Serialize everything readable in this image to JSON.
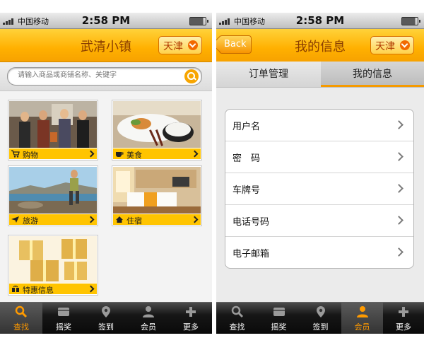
{
  "left_screen": {
    "status": {
      "carrier": "中国移动",
      "time": "2:58 PM"
    },
    "title": "武清小镇",
    "city": "天津",
    "search_placeholder": "请输入商品或商铺名称、关键字",
    "tiles": [
      {
        "label": "购物",
        "icon": "cart-icon"
      },
      {
        "label": "美食",
        "icon": "cup-icon"
      },
      {
        "label": "旅游",
        "icon": "plane-icon"
      },
      {
        "label": "住宿",
        "icon": "house-icon"
      },
      {
        "label": "特惠信息",
        "icon": "gift-icon"
      }
    ],
    "tabs": [
      {
        "label": "查找",
        "icon": "search-icon",
        "active": true
      },
      {
        "label": "摇奖",
        "icon": "card-icon",
        "active": false
      },
      {
        "label": "签到",
        "icon": "location-pin-icon",
        "active": false
      },
      {
        "label": "会员",
        "icon": "person-icon",
        "active": false
      },
      {
        "label": "更多",
        "icon": "plus-icon",
        "active": false
      }
    ]
  },
  "right_screen": {
    "status": {
      "carrier": "中国移动",
      "time": "2:58 PM"
    },
    "back_label": "Back",
    "title": "我的信息",
    "city": "天津",
    "segments": [
      {
        "label": "订单管理",
        "selected": false
      },
      {
        "label": "我的信息",
        "selected": true
      }
    ],
    "rows": [
      {
        "label": "用户名"
      },
      {
        "label": "密　码"
      },
      {
        "label": "车牌号"
      },
      {
        "label": "电话号码"
      },
      {
        "label": "电子邮箱"
      }
    ],
    "tabs": [
      {
        "label": "查找",
        "icon": "search-icon",
        "active": false
      },
      {
        "label": "摇奖",
        "icon": "card-icon",
        "active": false
      },
      {
        "label": "签到",
        "icon": "location-pin-icon",
        "active": false
      },
      {
        "label": "会员",
        "icon": "person-icon",
        "active": true
      },
      {
        "label": "更多",
        "icon": "plus-icon",
        "active": false
      }
    ]
  },
  "colors": {
    "accent": "#ffb000",
    "tab_active": "#ff9a00",
    "tile_bar": "#ffc400"
  }
}
